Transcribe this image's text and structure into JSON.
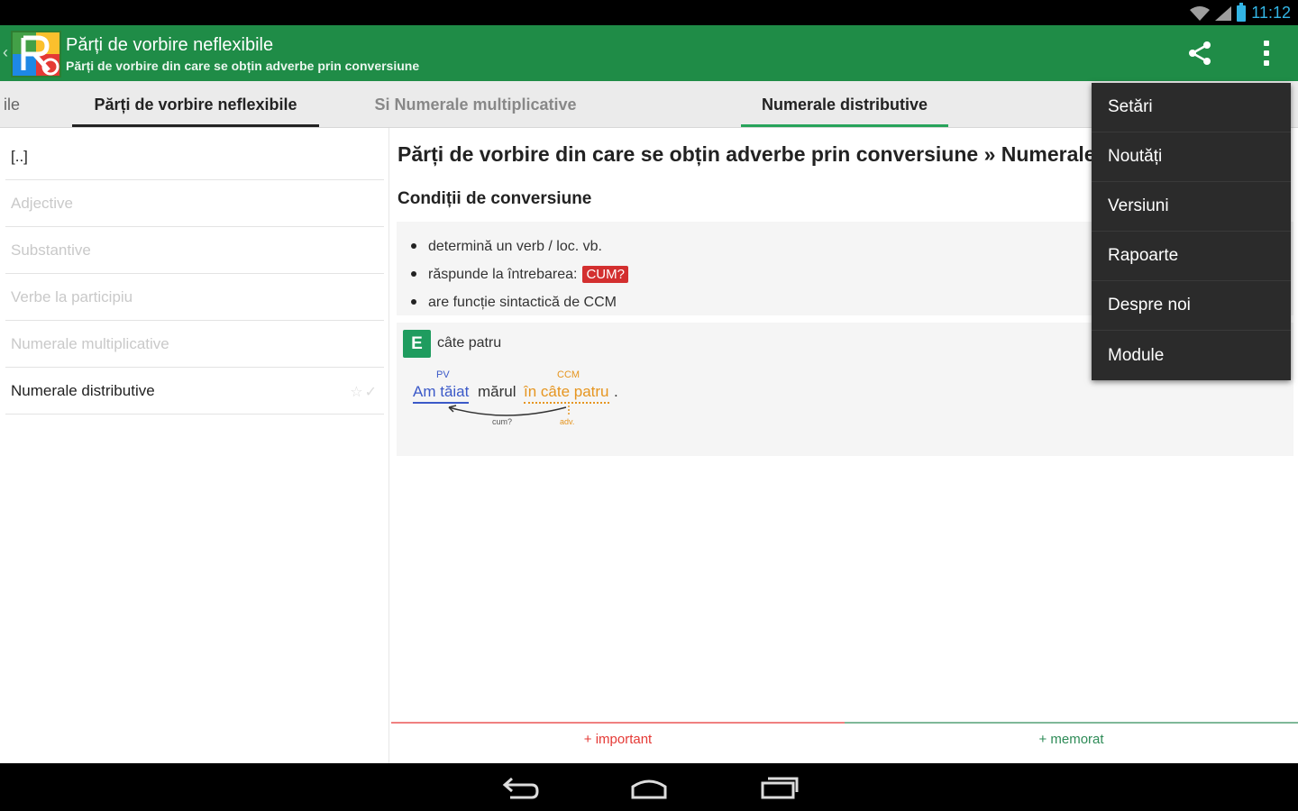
{
  "status": {
    "time": "11:12"
  },
  "actionbar": {
    "title": "Părți de vorbire neflexibile",
    "subtitle": "Părți de vorbire din care se obțin adverbe prin conversiune",
    "up_glyph": "‹"
  },
  "tabs": [
    {
      "label": "ile"
    },
    {
      "label": "Părți de vorbire neflexibile"
    },
    {
      "label": "Si Numerale multiplicative"
    },
    {
      "label": "Numerale distributive"
    }
  ],
  "list": {
    "items": [
      {
        "label": "[..]"
      },
      {
        "label": "Adjective"
      },
      {
        "label": "Substantive"
      },
      {
        "label": "Verbe la participiu"
      },
      {
        "label": "Numerale multiplicative"
      },
      {
        "label": "Numerale distributive",
        "icons": "☆✓"
      }
    ]
  },
  "content": {
    "title": "Părți de vorbire din care se obțin adverbe prin conversiune » Numerale",
    "section": "Condiții de conversiune",
    "conditions": [
      "determină un verb / loc. vb.",
      "răspunde la întrebarea:",
      "are funcție sintactică de CCM"
    ],
    "cum_badge": "CUM?",
    "example": {
      "badge": "E",
      "label": "câte patru",
      "pv_tag": "PV",
      "ccm_tag": "CCM",
      "part1": "Am tăiat",
      "part2": "mărul",
      "part3": "în câte patru",
      "part4": ".",
      "arc_label": "cum?",
      "adv_label": "adv."
    }
  },
  "bottom": {
    "important": "+ important",
    "memorat": "+ memorat"
  },
  "menu": {
    "items": [
      {
        "label": "Setări"
      },
      {
        "label": "Noutăți"
      },
      {
        "label": "Versiuni"
      },
      {
        "label": "Rapoarte"
      },
      {
        "label": "Despre noi"
      },
      {
        "label": "Module"
      }
    ]
  },
  "colors": {
    "actionbar": "#1f8c47",
    "tab_indicator": "#27a35a",
    "cum_badge": "#d32f2f",
    "example_badge": "#1f9c5f",
    "pv_color": "#3b59c8",
    "ccm_color": "#e6951f",
    "menu_bg": "#2b2b2b"
  },
  "icons": {
    "share": "share-icon",
    "overflow": "overflow-menu-icon",
    "back": "back-nav-icon",
    "home": "home-nav-icon",
    "recents": "recents-nav-icon"
  }
}
